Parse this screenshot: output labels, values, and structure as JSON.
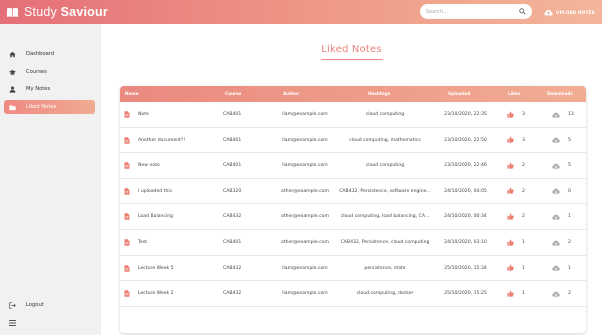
{
  "app": {
    "title_light": "Study ",
    "title_bold": "Saviour"
  },
  "header": {
    "search_placeholder": "Search...",
    "upload_label": "UPLOAD NOTES"
  },
  "sidebar": {
    "items": [
      {
        "label": "Dashboard",
        "icon": "home-icon"
      },
      {
        "label": "Courses",
        "icon": "graduation-cap-icon"
      },
      {
        "label": "My Notes",
        "icon": "user-icon"
      },
      {
        "label": "Liked Notes",
        "icon": "folder-icon",
        "active": true
      }
    ],
    "logout_label": "Logout"
  },
  "page": {
    "title": "Liked Notes"
  },
  "table": {
    "headers": {
      "name": "Name",
      "course": "Course",
      "author": "Author",
      "hashtags": "Hashtags",
      "uploaded": "Uploaded",
      "likes": "Likes",
      "downloads": "Downloads"
    },
    "rows": [
      {
        "name": "Note",
        "course": "CAB401",
        "author": "liam@example.com",
        "hashtags": "cloud computing",
        "uploaded": "23/10/2020, 22:35",
        "likes": "3",
        "downloads": "13"
      },
      {
        "name": "Another document?!",
        "course": "CAB401",
        "author": "liam@example.com",
        "hashtags": "cloud computing, mathematics",
        "uploaded": "23/10/2020, 22:50",
        "likes": "3",
        "downloads": "5"
      },
      {
        "name": "New note",
        "course": "CAB401",
        "author": "liam@example.com",
        "hashtags": "cloud computing",
        "uploaded": "23/10/2020, 22:46",
        "likes": "2",
        "downloads": "5"
      },
      {
        "name": "I uploaded this",
        "course": "CAB320",
        "author": "other@example.com",
        "hashtags": "CAB432, Persistence, software engine...",
        "uploaded": "24/10/2020, 04:05",
        "likes": "2",
        "downloads": "0"
      },
      {
        "name": "Load Balancing",
        "course": "CAB432",
        "author": "other@example.com",
        "hashtags": "cloud computing, load balancing, CA...",
        "uploaded": "24/10/2020, 00:34",
        "likes": "2",
        "downloads": "1"
      },
      {
        "name": "Test",
        "course": "CAB401",
        "author": "other@example.com",
        "hashtags": "CAB432, Persistence, cloud computing",
        "uploaded": "24/10/2020, 03:10",
        "likes": "1",
        "downloads": "2"
      },
      {
        "name": "Lecture Week 5",
        "course": "CAB432",
        "author": "liam@example.com",
        "hashtags": "persistence, state",
        "uploaded": "25/10/2020, 15:34",
        "likes": "1",
        "downloads": "1"
      },
      {
        "name": "Lecture Week 2",
        "course": "CAB432",
        "author": "liam@example.com",
        "hashtags": "cloud computing, docker",
        "uploaded": "25/10/2020, 15:25",
        "likes": "1",
        "downloads": "2"
      }
    ]
  },
  "colors": {
    "accent": "#e9837d",
    "header_gradient_start": "#e56f78",
    "header_gradient_end": "#f3b69a",
    "sidebar_bg": "#f1f1f1"
  }
}
